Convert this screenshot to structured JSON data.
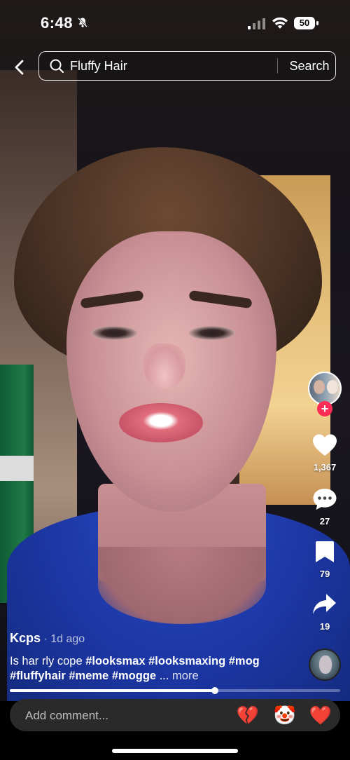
{
  "status_bar": {
    "time": "6:48",
    "battery": "50"
  },
  "search": {
    "query": "Fluffy Hair",
    "submit_label": "Search"
  },
  "actions": {
    "likes": "1,367",
    "comments": "27",
    "saves": "79",
    "shares": "19",
    "follow_symbol": "+"
  },
  "post": {
    "author": "Kcps",
    "meta": " · 1d ago",
    "text": "Is har rly cope",
    "hashtags": [
      "#looksmax",
      "#looksmaxing",
      "#mog",
      "#fluffyhair",
      "#meme",
      "#mogge"
    ],
    "ellipsis": "...",
    "more_label": "more"
  },
  "playback": {
    "progress": 0.62
  },
  "comment": {
    "placeholder": "Add comment...",
    "emojis": [
      "💔",
      "🤡",
      "❤️"
    ]
  },
  "colors": {
    "accent": "#ff2c55",
    "comment_bar": "#2a2a2a"
  },
  "icons": [
    "bell-slash-icon",
    "signal-icon",
    "wifi-icon",
    "battery-icon",
    "back-icon",
    "search-icon",
    "heart-icon",
    "comment-icon",
    "bookmark-icon",
    "share-icon"
  ]
}
